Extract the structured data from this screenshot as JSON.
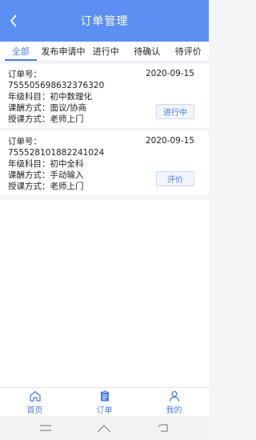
{
  "header": {
    "title": "订单管理"
  },
  "tabs": [
    {
      "label": "全部"
    },
    {
      "label": "发布申请中"
    },
    {
      "label": "进行中"
    },
    {
      "label": "待确认"
    },
    {
      "label": "待评价"
    }
  ],
  "orders": [
    {
      "number_label": "订单号：",
      "number": "755505698632376320",
      "date": "2020-09-15",
      "grade_subject": "年级科目：初中数理化",
      "pay_method": "课酬方式：面议/协商",
      "teach_method": "授课方式：老师上门",
      "button": "进行中"
    },
    {
      "number_label": "订单号：",
      "number": "755528101882241024",
      "date": "2020-09-15",
      "grade_subject": "年级科目：初中全科",
      "pay_method": "课酬方式：手动输入",
      "teach_method": "授课方式：老师上门",
      "button": "评价"
    }
  ],
  "bottom_nav": [
    {
      "label": "首页",
      "icon": "home-icon"
    },
    {
      "label": "订单",
      "icon": "clipboard-icon"
    },
    {
      "label": "我的",
      "icon": "user-icon"
    }
  ],
  "colors": {
    "accent": "#5c8ff2",
    "active": "#4a7fe8"
  }
}
